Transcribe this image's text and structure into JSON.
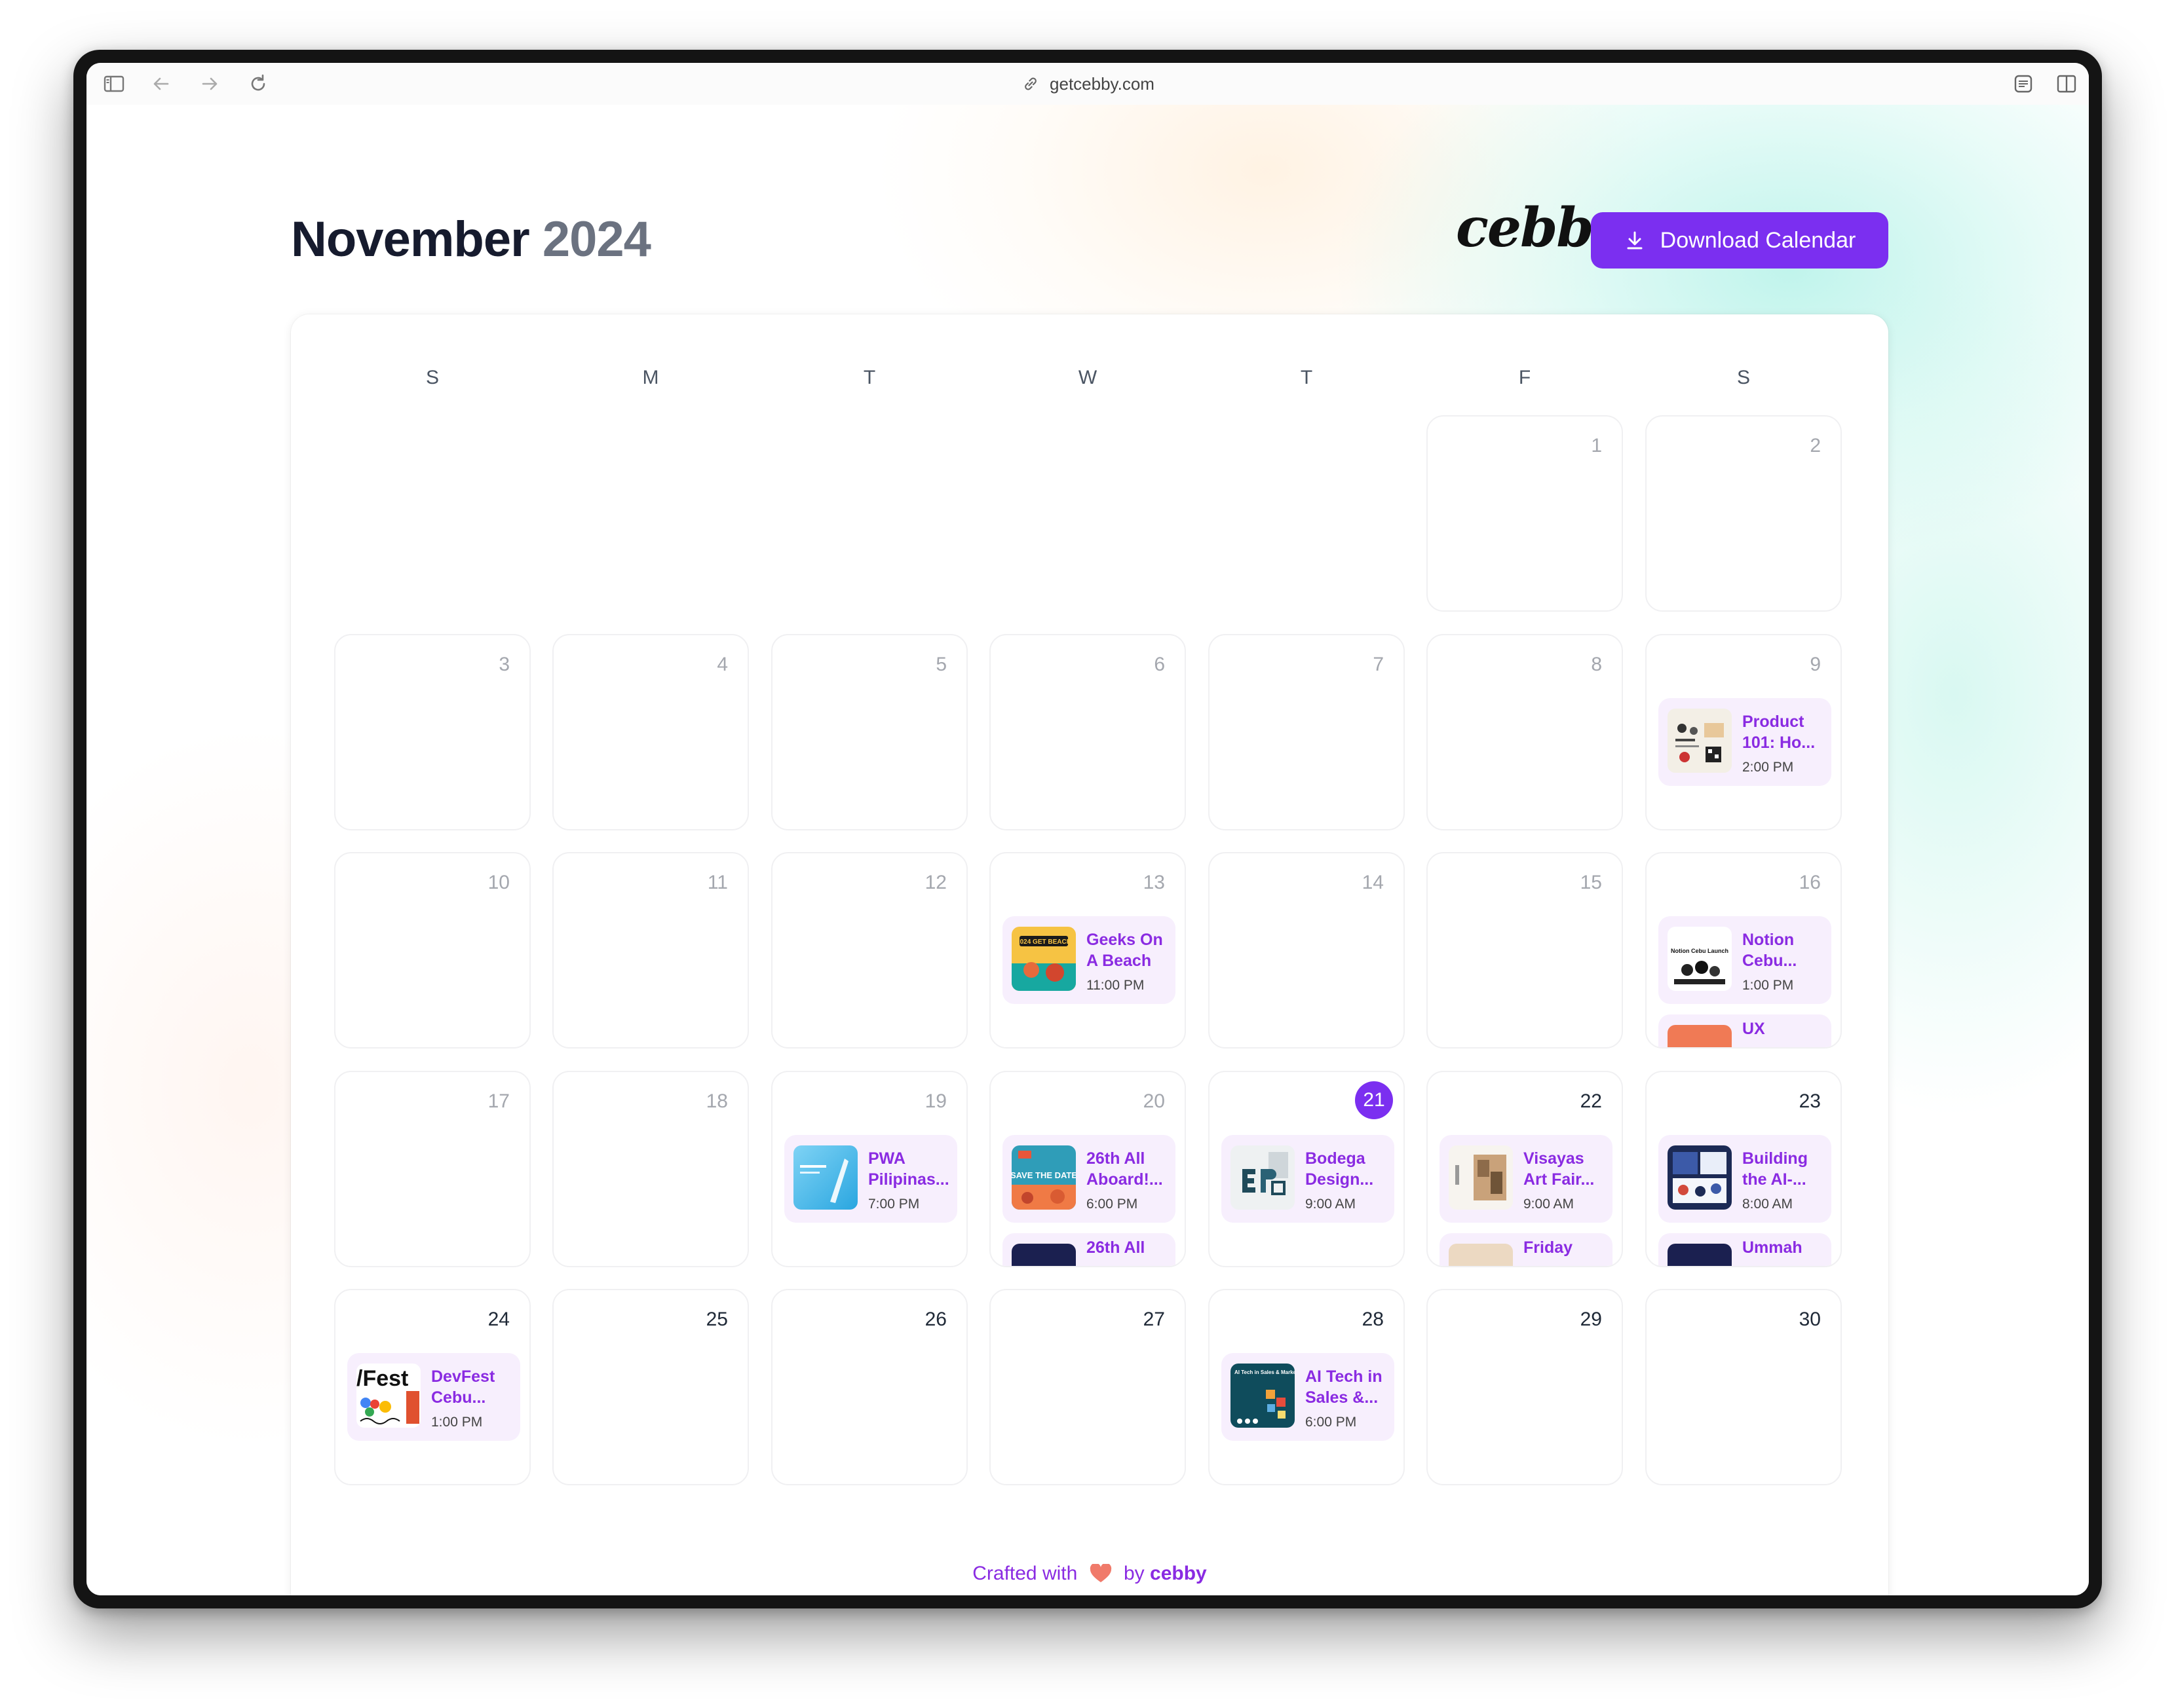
{
  "browser": {
    "url": "getcebby.com",
    "icons": [
      "sidebar-icon",
      "back-icon",
      "forward-icon",
      "reload-icon",
      "link-icon",
      "reader-icon",
      "split-view-icon"
    ]
  },
  "header": {
    "month": "November",
    "year": "2024",
    "logo": "cebby",
    "download_label": "Download Calendar",
    "accent": "#7b2ff0"
  },
  "calendar": {
    "weekdays": [
      "S",
      "M",
      "T",
      "W",
      "T",
      "F",
      "S"
    ],
    "today": "21",
    "days": {
      "d1": "1",
      "d2": "2",
      "d3": "3",
      "d4": "4",
      "d5": "5",
      "d6": "6",
      "d7": "7",
      "d8": "8",
      "d9": "9",
      "d10": "10",
      "d11": "11",
      "d12": "12",
      "d13": "13",
      "d14": "14",
      "d15": "15",
      "d16": "16",
      "d17": "17",
      "d18": "18",
      "d19": "19",
      "d20": "20",
      "d21": "21",
      "d22": "22",
      "d23": "23",
      "d24": "24",
      "d25": "25",
      "d26": "26",
      "d27": "27",
      "d28": "28",
      "d29": "29",
      "d30": "30"
    },
    "events": {
      "e9": {
        "title": "Product 101: Ho...",
        "time": "2:00 PM"
      },
      "e13": {
        "title": "Geeks On A Beach",
        "time": "11:00 PM",
        "thumb_text": "2024 GET BEACH"
      },
      "e16": {
        "title": "Notion Cebu...",
        "time": "1:00 PM",
        "thumb_text": "Notion Cebu Launch"
      },
      "e16b": {
        "title": "UX"
      },
      "e19": {
        "title": "PWA Pilipinas...",
        "time": "7:00 PM"
      },
      "e20": {
        "title": "26th All Aboard!...",
        "time": "6:00 PM",
        "thumb_text": "SAVE THE DATE"
      },
      "e20b": {
        "title": "26th All"
      },
      "e21": {
        "title": "Bodega Design...",
        "time": "9:00 AM"
      },
      "e22": {
        "title": "Visayas Art Fair...",
        "time": "9:00 AM"
      },
      "e22b": {
        "title": "Friday"
      },
      "e23": {
        "title": "Building the AI-...",
        "time": "8:00 AM"
      },
      "e23b": {
        "title": "Ummah"
      },
      "e24": {
        "title": "DevFest Cebu...",
        "time": "1:00 PM",
        "thumb_text": "/Fest"
      },
      "e28": {
        "title": "AI Tech in Sales &...",
        "time": "6:00 PM",
        "thumb_text": "AI Tech in Sales & Marketing"
      }
    }
  },
  "footer": {
    "crafted": "Crafted with",
    "by": "by",
    "brand": "cebby"
  }
}
